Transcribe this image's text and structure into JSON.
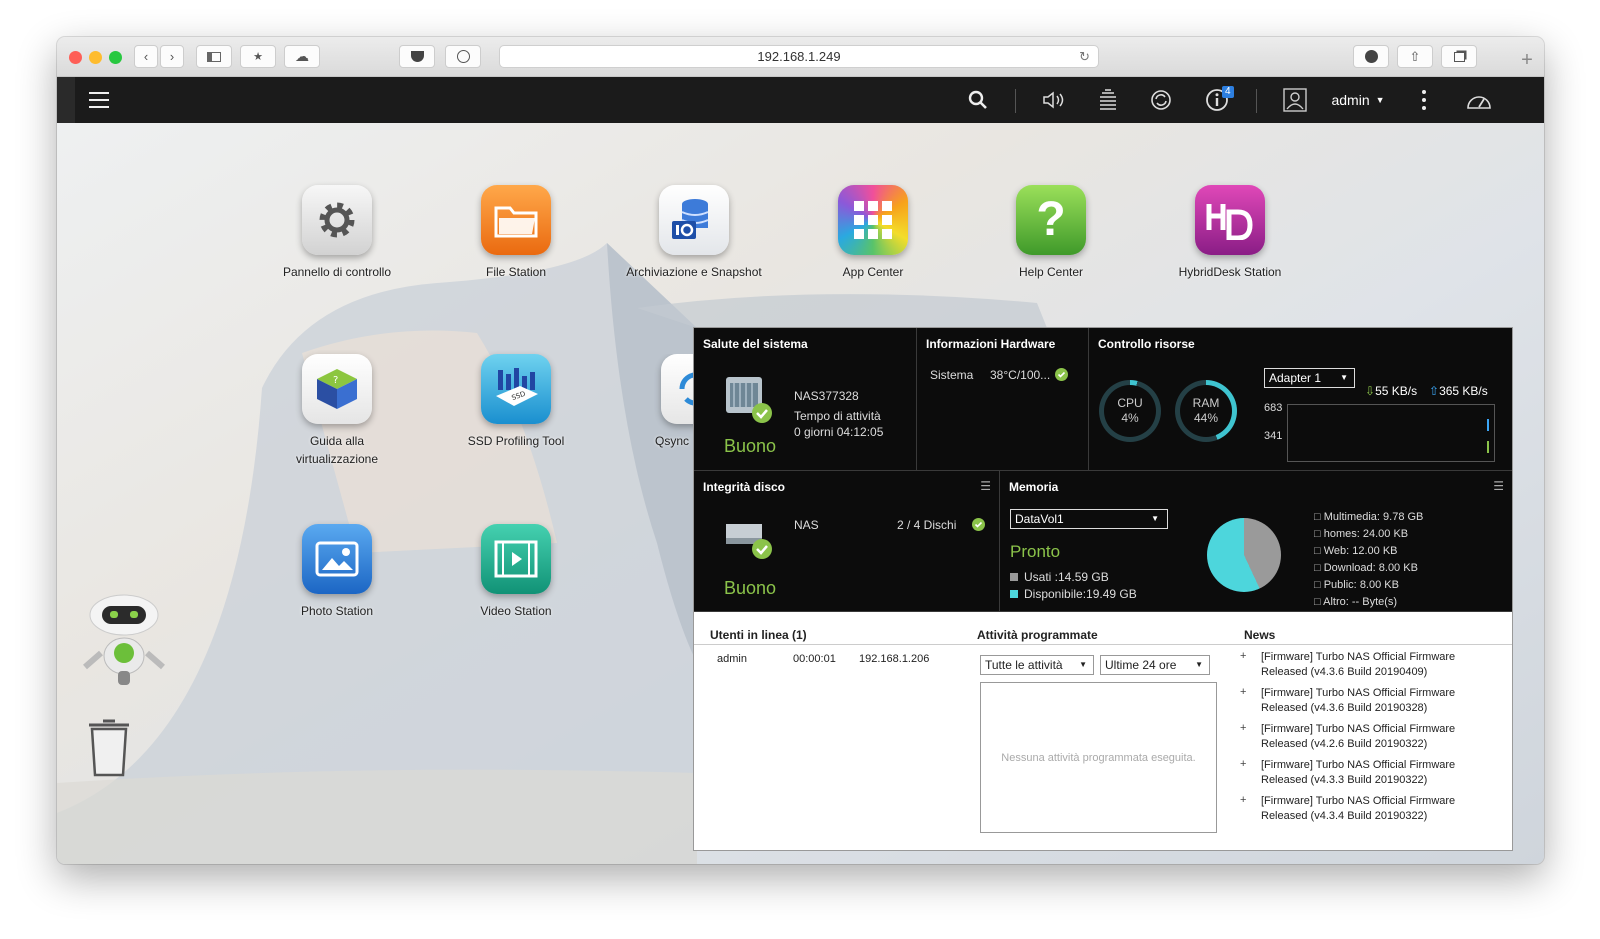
{
  "browser": {
    "url": "192.168.1.249"
  },
  "topbar": {
    "user": "admin",
    "notification_count": "4"
  },
  "apps": [
    {
      "label": "Pannello di controllo"
    },
    {
      "label": "File Station"
    },
    {
      "label": "Archiviazione e Snapshot"
    },
    {
      "label": "App Center"
    },
    {
      "label": "Help Center"
    },
    {
      "label": "HybridDesk Station"
    },
    {
      "label": "Guida alla virtualizzazione"
    },
    {
      "label": "SSD Profiling Tool"
    },
    {
      "label": "Qsync"
    },
    {
      "label": "Photo Station"
    },
    {
      "label": "Video Station"
    }
  ],
  "health": {
    "title": "Salute del sistema",
    "name": "NAS377328",
    "uptime_label": "Tempo di attività",
    "uptime": "0 giorni 04:12:05",
    "status": "Buono"
  },
  "hardware": {
    "title": "Informazioni Hardware",
    "system_label": "Sistema",
    "system_value": "38°C/100..."
  },
  "resources": {
    "title": "Controllo risorse",
    "cpu_label": "CPU",
    "cpu_value": "4%",
    "cpu_fraction": 0.04,
    "ram_label": "RAM",
    "ram_value": "44%",
    "ram_fraction": 0.44,
    "adapter": "Adapter 1",
    "down": "55 KB/s",
    "up": "365 KB/s",
    "y_top": "683",
    "y_mid": "341"
  },
  "disk": {
    "title": "Integrità disco",
    "name": "NAS",
    "disks": "2 / 4 Dischi",
    "status": "Buono"
  },
  "memory": {
    "title": "Memoria",
    "volume": "DataVol1",
    "status": "Pronto",
    "used_label": "Usati :14.59 GB",
    "free_label": "Disponibile:19.49 GB",
    "used_fraction": 0.43,
    "folders": [
      {
        "name": "Multimedia:",
        "size": "9.78 GB"
      },
      {
        "name": "homes:",
        "size": "24.00 KB"
      },
      {
        "name": "Web:",
        "size": "12.00 KB"
      },
      {
        "name": "Download:",
        "size": "8.00 KB"
      },
      {
        "name": "Public:",
        "size": "8.00 KB"
      },
      {
        "name": "Altro:",
        "size": "-- Byte(s)"
      }
    ]
  },
  "users": {
    "title": "Utenti in linea (1)",
    "name": "admin",
    "time": "00:00:01",
    "ip": "192.168.1.206"
  },
  "tasks": {
    "title": "Attività programmate",
    "filter1": "Tutte le attività",
    "filter2": "Ultime 24 ore",
    "empty": "Nessuna attività programmata eseguita."
  },
  "news": {
    "title": "News",
    "items": [
      {
        "line1": "[Firmware] Turbo NAS Official Firmware",
        "line2": "Released (v4.3.6 Build 20190409)"
      },
      {
        "line1": "[Firmware] Turbo NAS Official Firmware",
        "line2": "Released (v4.3.6 Build 20190328)"
      },
      {
        "line1": "[Firmware] Turbo NAS Official Firmware",
        "line2": "Released (v4.2.6 Build 20190322)"
      },
      {
        "line1": "[Firmware] Turbo NAS Official Firmware",
        "line2": "Released (v4.3.3 Build 20190322)"
      },
      {
        "line1": "[Firmware] Turbo NAS Official Firmware",
        "line2": "Released (v4.3.4 Build 20190322)"
      }
    ]
  }
}
